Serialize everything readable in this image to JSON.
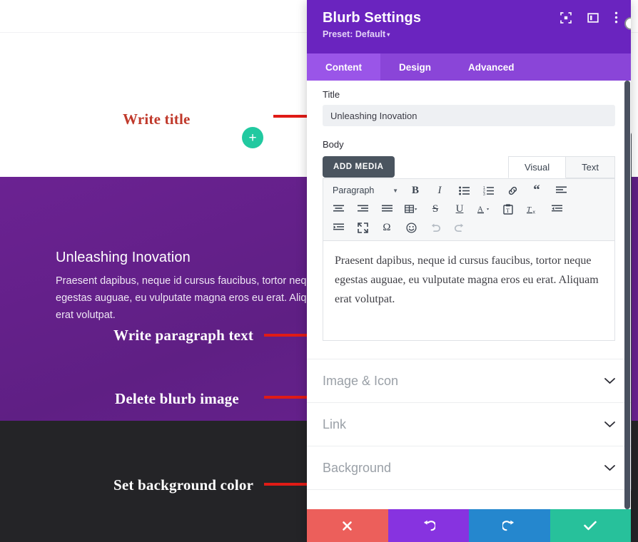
{
  "page_preview": {
    "annotations": [
      {
        "text": "Write title",
        "style": "red"
      },
      {
        "text": "Write paragraph text",
        "style": "white"
      },
      {
        "text": "Delete blurb image",
        "style": "white"
      },
      {
        "text": "Set background color",
        "style": "white"
      }
    ],
    "add_module_button": "+",
    "blurb": {
      "title": "Unleashing Inovation",
      "body": "Praesent dapibus, neque id cursus faucibus, tortor neque egestas auguae, eu vulputate magna eros eu erat. Aliquam erat volutpat."
    }
  },
  "panel": {
    "title": "Blurb Settings",
    "preset_label": "Preset: Default",
    "preset_caret": "▾",
    "header_icons": [
      {
        "name": "fullscreen-icon"
      },
      {
        "name": "panel-layout-icon"
      },
      {
        "name": "more-options-icon"
      }
    ],
    "tabs": [
      {
        "label": "Content",
        "active": true
      },
      {
        "label": "Design",
        "active": false
      },
      {
        "label": "Advanced",
        "active": false
      }
    ],
    "title_field": {
      "label": "Title",
      "value": "Unleashing Inovation",
      "placeholder": ""
    },
    "body_field": {
      "label": "Body",
      "add_media_label": "ADD MEDIA",
      "editor_tabs": [
        {
          "label": "Visual",
          "active": true
        },
        {
          "label": "Text",
          "active": false
        }
      ],
      "format_select": "Paragraph",
      "content": "Praesent dapibus, neque id cursus faucibus, tortor neque egestas auguae, eu vulputate magna eros eu erat. Aliquam erat volutpat.",
      "toolbar_rows": [
        [
          {
            "icon": "paragraph-format-select",
            "glyph": "Paragraph",
            "type": "select"
          },
          {
            "icon": "bold-icon",
            "glyph": "B"
          },
          {
            "icon": "italic-icon",
            "glyph": "I"
          },
          {
            "icon": "bulleted-list-icon",
            "glyph": "list"
          },
          {
            "icon": "numbered-list-icon",
            "glyph": "numlist"
          },
          {
            "icon": "link-icon",
            "glyph": "link"
          },
          {
            "icon": "blockquote-icon",
            "glyph": "quote"
          },
          {
            "icon": "align-left-icon",
            "glyph": "alignleft"
          }
        ],
        [
          {
            "icon": "align-center-icon",
            "glyph": "aligncenter"
          },
          {
            "icon": "align-right-icon",
            "glyph": "alignright"
          },
          {
            "icon": "align-justify-icon",
            "glyph": "alignjustify"
          },
          {
            "icon": "table-icon",
            "glyph": "table"
          },
          {
            "icon": "strikethrough-icon",
            "glyph": "S"
          },
          {
            "icon": "underline-icon",
            "glyph": "U"
          },
          {
            "icon": "text-color-icon",
            "glyph": "A"
          },
          {
            "icon": "paste-as-text-icon",
            "glyph": "paste"
          },
          {
            "icon": "clear-formatting-icon",
            "glyph": "Tx"
          },
          {
            "icon": "outdent-icon",
            "glyph": "outdent"
          }
        ],
        [
          {
            "icon": "indent-icon",
            "glyph": "indent"
          },
          {
            "icon": "fullscreen-editor-icon",
            "glyph": "expand"
          },
          {
            "icon": "special-character-icon",
            "glyph": "Ω"
          },
          {
            "icon": "emoji-icon",
            "glyph": "☺"
          },
          {
            "icon": "undo-icon",
            "glyph": "↩",
            "disabled": true
          },
          {
            "icon": "redo-icon",
            "glyph": "↪",
            "disabled": true
          }
        ]
      ]
    },
    "sections": [
      {
        "label": "Image & Icon",
        "chevron": "⌄"
      },
      {
        "label": "Link",
        "chevron": "⌄"
      },
      {
        "label": "Background",
        "chevron": "⌄"
      }
    ],
    "footer_buttons": [
      {
        "name": "cancel-button",
        "glyph": "✖",
        "color": "#ec5f5b"
      },
      {
        "name": "undo-button",
        "glyph": "↺",
        "color": "#8733e0"
      },
      {
        "name": "redo-button",
        "glyph": "↻",
        "color": "#2587ce"
      },
      {
        "name": "save-button",
        "glyph": "✔",
        "color": "#27c19b"
      }
    ]
  },
  "colors": {
    "panel_header": "#6a24bf",
    "panel_tabs": "#8a45d8",
    "panel_tab_active": "#9a55e8",
    "section_purple": "#66218c",
    "section_dark": "#242427",
    "annotation_red": "#c0392b",
    "arrow_red": "#e01b16",
    "add_button_green": "#21c9a0"
  }
}
